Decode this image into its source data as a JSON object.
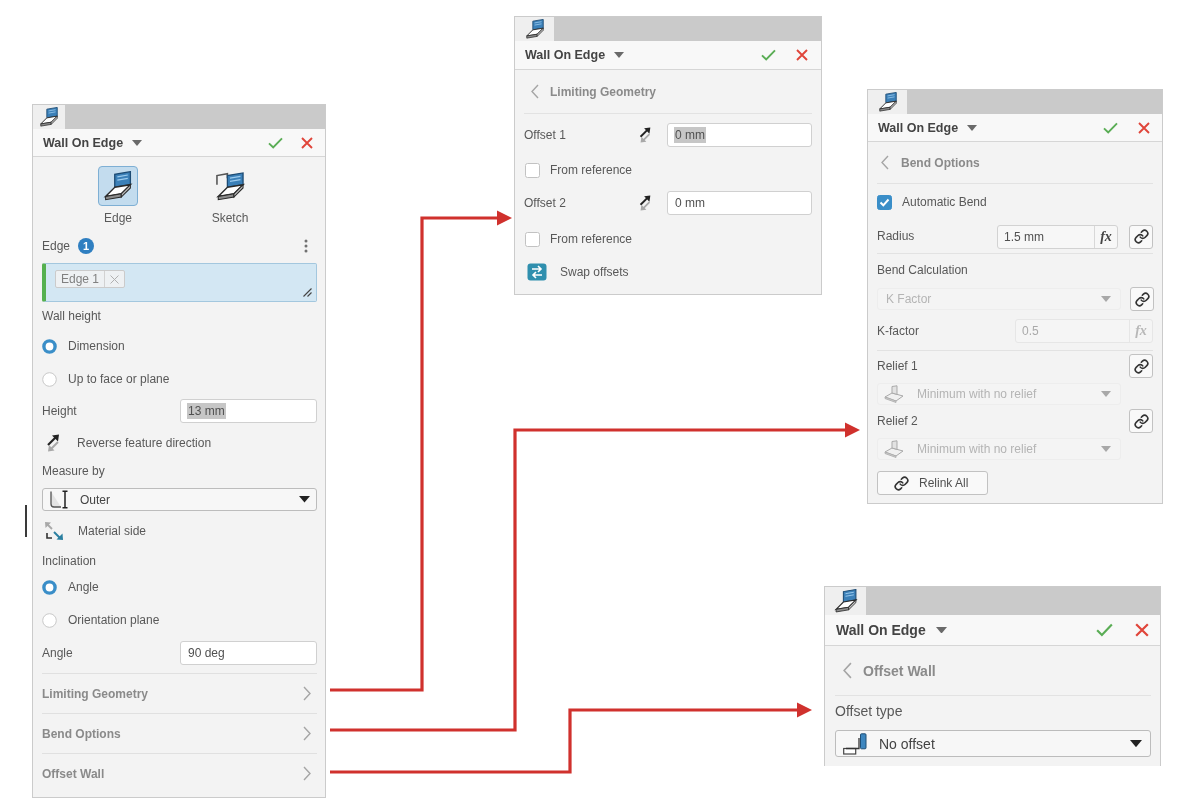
{
  "main_panel": {
    "title": "Wall On Edge",
    "modes": [
      {
        "kind": "edge",
        "label": "Edge",
        "selected": true
      },
      {
        "kind": "sketch",
        "label": "Sketch",
        "selected": false
      }
    ],
    "edge_selection": {
      "label": "Edge",
      "count": "1",
      "chips": [
        "Edge 1"
      ]
    },
    "wall_height": {
      "label": "Wall height",
      "options": [
        {
          "label": "Dimension",
          "selected": true
        },
        {
          "label": "Up to face or plane",
          "selected": false
        }
      ]
    },
    "height": {
      "label": "Height",
      "value": "13 mm",
      "text_selected": true
    },
    "reverse_direction": {
      "label": "Reverse feature direction"
    },
    "measure_by": {
      "label": "Measure by",
      "value": "Outer"
    },
    "material_side": {
      "label": "Material side"
    },
    "inclination": {
      "label": "Inclination",
      "options": [
        {
          "label": "Angle",
          "selected": true
        },
        {
          "label": "Orientation plane",
          "selected": false
        }
      ]
    },
    "angle": {
      "label": "Angle",
      "value": "90 deg"
    },
    "sections": [
      {
        "label": "Limiting Geometry"
      },
      {
        "label": "Bend Options"
      },
      {
        "label": "Offset Wall"
      }
    ]
  },
  "limiting_geometry_panel": {
    "title": "Wall On Edge",
    "back_label": "Limiting Geometry",
    "offsets": [
      {
        "label": "Offset 1",
        "value": "0 mm",
        "text_selected": true,
        "from_reference": {
          "label": "From reference",
          "checked": false
        }
      },
      {
        "label": "Offset 2",
        "value": "0 mm",
        "text_selected": false,
        "from_reference": {
          "label": "From reference",
          "checked": false
        }
      }
    ],
    "swap_label": "Swap offsets"
  },
  "bend_options_panel": {
    "title": "Wall On Edge",
    "back_label": "Bend Options",
    "automatic_bend": {
      "label": "Automatic Bend",
      "checked": true
    },
    "radius": {
      "label": "Radius",
      "value": "1.5 mm",
      "formula_label": "fx"
    },
    "bend_calculation": {
      "label": "Bend Calculation",
      "value": "K Factor",
      "disabled": true
    },
    "k_factor": {
      "label": "K-factor",
      "value": "0.5",
      "formula_label": "fx",
      "disabled": true
    },
    "reliefs": [
      {
        "label": "Relief 1",
        "value": "Minimum with no relief",
        "disabled": true
      },
      {
        "label": "Relief 2",
        "value": "Minimum with no relief",
        "disabled": true
      }
    ],
    "relink_label": "Relink All"
  },
  "offset_wall_panel": {
    "title": "Wall On Edge",
    "back_label": "Offset Wall",
    "offset_type": {
      "label": "Offset type",
      "value": "No offset"
    }
  }
}
